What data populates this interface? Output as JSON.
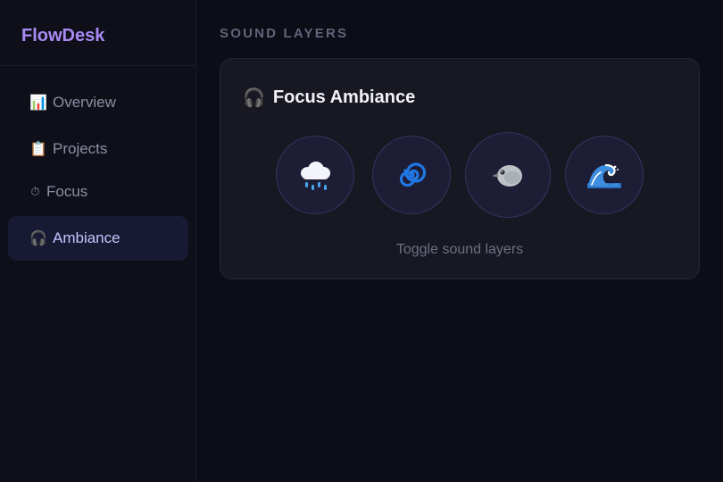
{
  "app": {
    "brand": "FlowDesk"
  },
  "sidebar": {
    "items": [
      {
        "icon": "📊",
        "label": "Overview",
        "active": false
      },
      {
        "icon": "📋",
        "label": "Projects",
        "active": false
      },
      {
        "icon": "⏱",
        "label": "Focus",
        "active": false
      },
      {
        "icon": "🎧",
        "label": "Ambiance",
        "active": true
      }
    ]
  },
  "main": {
    "section_title": "SOUND LAYERS",
    "card": {
      "title_icon": "🎧",
      "title": "Focus Ambiance",
      "layers": [
        {
          "name": "rain",
          "icon": "rain-cloud-icon"
        },
        {
          "name": "wind",
          "icon": "spiral-icon"
        },
        {
          "name": "birds",
          "icon": "bird-icon"
        },
        {
          "name": "waves",
          "icon": "wave-icon"
        }
      ],
      "hint": "Toggle sound layers"
    }
  },
  "colors": {
    "background": "#0c0d16",
    "sidebar": "#0e0f19",
    "brand": "#a98bf5",
    "active_item_bg": "#181a33",
    "active_item_text": "#c5c4ff",
    "card_bg": "#181823",
    "layer_button_bg": "#1d1d35"
  }
}
